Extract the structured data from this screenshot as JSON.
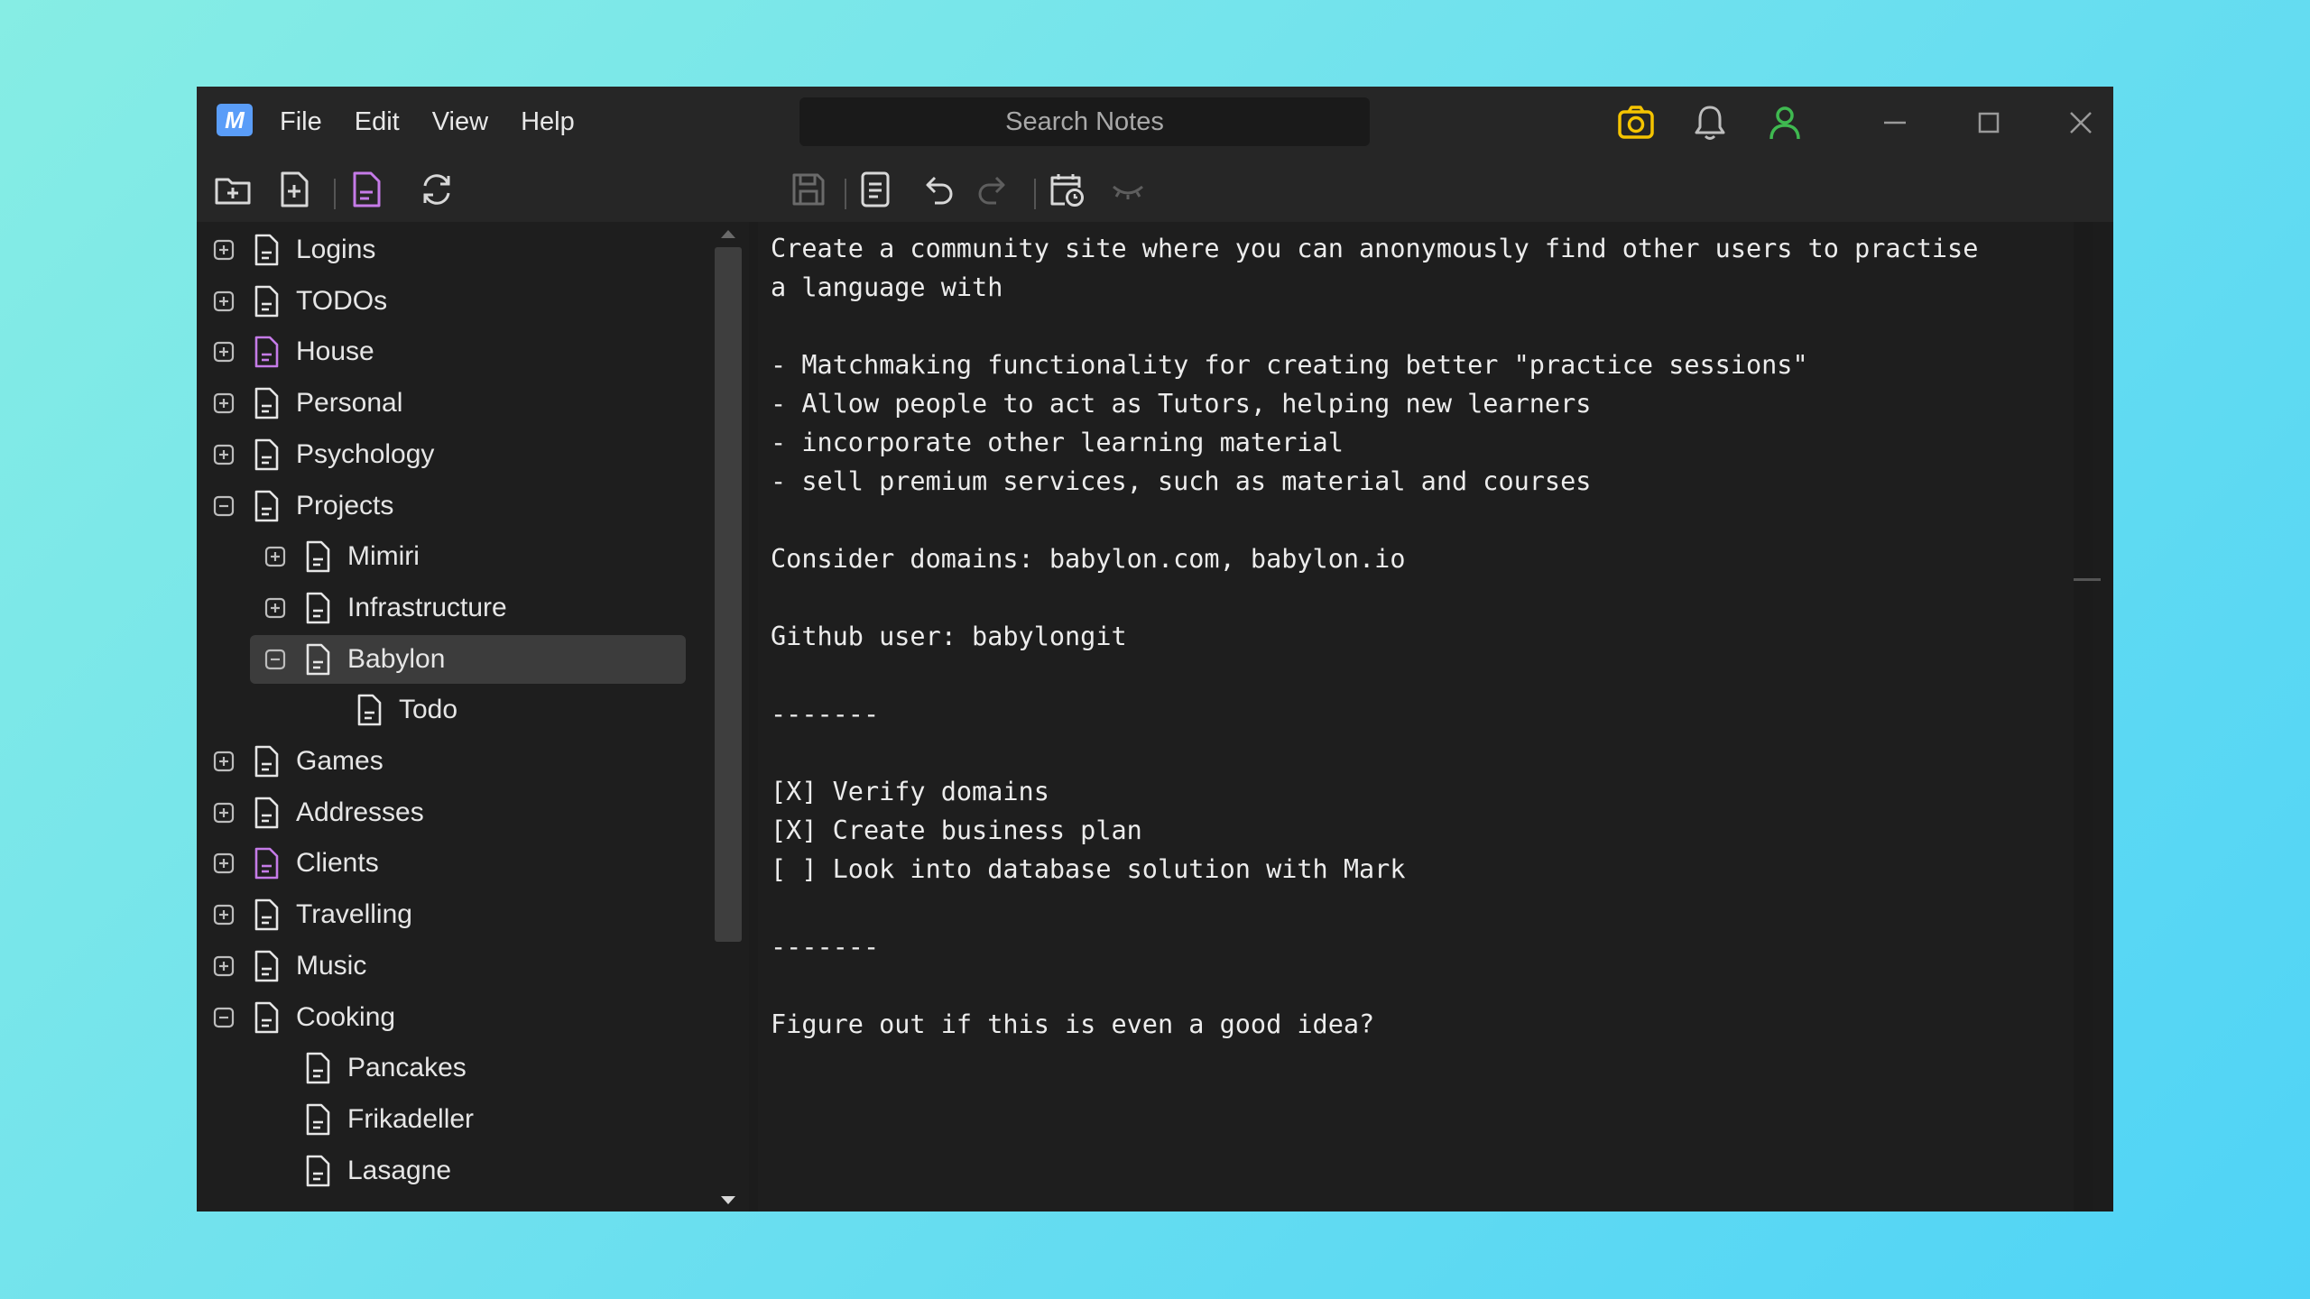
{
  "app": {
    "logo_text": "M",
    "menu": [
      "File",
      "Edit",
      "View",
      "Help"
    ],
    "search_placeholder": "Search Notes"
  },
  "titlebar_icons": [
    "camera-icon",
    "bell-icon",
    "user-icon"
  ],
  "window_controls": [
    "minimize-icon",
    "maximize-icon",
    "close-icon"
  ],
  "toolbar_left": [
    "new-folder-icon",
    "new-note-icon",
    "note-icon",
    "sync-icon"
  ],
  "toolbar_right": [
    "save-icon",
    "document-icon",
    "undo-icon",
    "redo-icon",
    "calendar-clock-icon",
    "eye-closed-icon"
  ],
  "colors": {
    "accent_purple": "#c57be8",
    "camera_yellow": "#f5c400",
    "user_green": "#3fb950",
    "selected_row": "#3c3c3c"
  },
  "tree": {
    "items": [
      {
        "label": "Logins",
        "level": 0,
        "expander": "plus",
        "icon_color": "white"
      },
      {
        "label": "TODOs",
        "level": 0,
        "expander": "plus",
        "icon_color": "white"
      },
      {
        "label": "House",
        "level": 0,
        "expander": "plus",
        "icon_color": "purple"
      },
      {
        "label": "Personal",
        "level": 0,
        "expander": "plus",
        "icon_color": "white"
      },
      {
        "label": "Psychology",
        "level": 0,
        "expander": "plus",
        "icon_color": "white"
      },
      {
        "label": "Projects",
        "level": 0,
        "expander": "minus",
        "icon_color": "white"
      },
      {
        "label": "Mimiri",
        "level": 1,
        "expander": "plus",
        "icon_color": "white"
      },
      {
        "label": "Infrastructure",
        "level": 1,
        "expander": "plus",
        "icon_color": "white"
      },
      {
        "label": "Babylon",
        "level": 1,
        "expander": "minus",
        "icon_color": "white",
        "selected": true
      },
      {
        "label": "Todo",
        "level": 2,
        "expander": "none",
        "icon_color": "white"
      },
      {
        "label": "Games",
        "level": 0,
        "expander": "plus",
        "icon_color": "white"
      },
      {
        "label": "Addresses",
        "level": 0,
        "expander": "plus",
        "icon_color": "white"
      },
      {
        "label": "Clients",
        "level": 0,
        "expander": "plus",
        "icon_color": "purple"
      },
      {
        "label": "Travelling",
        "level": 0,
        "expander": "plus",
        "icon_color": "white"
      },
      {
        "label": "Music",
        "level": 0,
        "expander": "plus",
        "icon_color": "white"
      },
      {
        "label": "Cooking",
        "level": 0,
        "expander": "minus",
        "icon_color": "white"
      },
      {
        "label": "Pancakes",
        "level": 1,
        "expander": "none",
        "icon_color": "white"
      },
      {
        "label": "Frikadeller",
        "level": 1,
        "expander": "none",
        "icon_color": "white"
      },
      {
        "label": "Lasagne",
        "level": 1,
        "expander": "none",
        "icon_color": "white"
      }
    ]
  },
  "editor": {
    "content": "Create a community site where you can anonymously find other users to practise\na language with\n\n- Matchmaking functionality for creating better \"practice sessions\"\n- Allow people to act as Tutors, helping new learners\n- incorporate other learning material\n- sell premium services, such as material and courses\n\nConsider domains: babylon.com, babylon.io\n\nGithub user: babylongit\n\n-------\n\n[X] Verify domains\n[X] Create business plan\n[ ] Look into database solution with Mark\n\n-------\n\nFigure out if this is even a good idea?"
  }
}
